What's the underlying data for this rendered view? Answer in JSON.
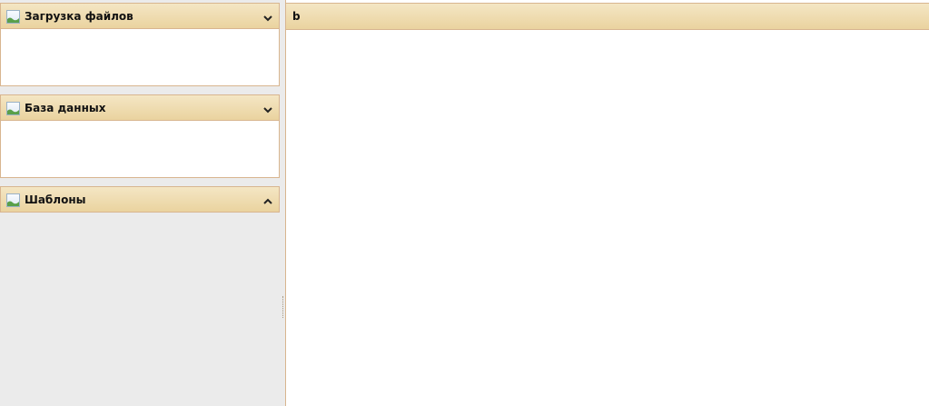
{
  "sidebar": {
    "panels": [
      {
        "title": "Загрузка файлов",
        "icon": "image-icon",
        "state": "expanded",
        "toggle_icon": "chevron-down-icon"
      },
      {
        "title": "База данных",
        "icon": "image-icon",
        "state": "expanded",
        "toggle_icon": "chevron-down-icon"
      },
      {
        "title": "Шаблоны",
        "icon": "image-icon",
        "state": "collapsed",
        "toggle_icon": "chevron-up-icon"
      }
    ]
  },
  "main": {
    "title": "b"
  },
  "colors": {
    "header_gradient_top": "#f4e6c4",
    "header_gradient_bottom": "#ead39f",
    "border": "#d8b58f",
    "background": "#ebebeb",
    "panel_body": "#ffffff"
  }
}
